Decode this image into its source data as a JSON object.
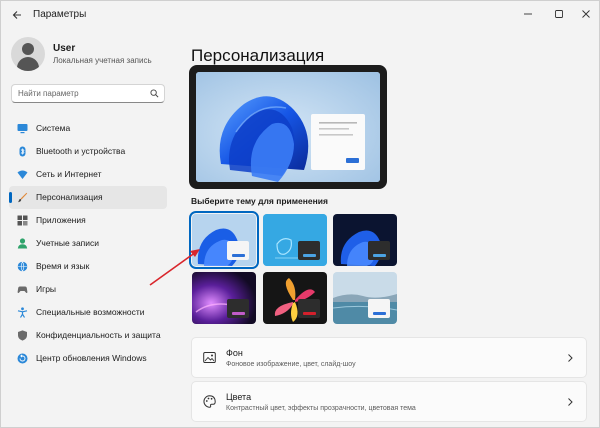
{
  "window": {
    "title": "Параметры"
  },
  "user": {
    "name": "User",
    "subtitle": "Локальная учетная запись"
  },
  "search": {
    "placeholder": "Найти параметр"
  },
  "sidebar": {
    "items": [
      {
        "label": "Система",
        "icon": "system-icon"
      },
      {
        "label": "Bluetooth и устройства",
        "icon": "bluetooth-icon"
      },
      {
        "label": "Сеть и Интернет",
        "icon": "network-icon"
      },
      {
        "label": "Персонализация",
        "icon": "brush-icon",
        "active": true
      },
      {
        "label": "Приложения",
        "icon": "apps-icon"
      },
      {
        "label": "Учетные записи",
        "icon": "accounts-icon"
      },
      {
        "label": "Время и язык",
        "icon": "globe-icon"
      },
      {
        "label": "Игры",
        "icon": "gamepad-icon"
      },
      {
        "label": "Специальные возможности",
        "icon": "accessibility-icon"
      },
      {
        "label": "Конфиденциальность и защита",
        "icon": "shield-icon"
      },
      {
        "label": "Центр обновления Windows",
        "icon": "update-icon"
      }
    ]
  },
  "main": {
    "title": "Персонализация",
    "theme_label": "Выберите тему для применения",
    "cards": [
      {
        "title": "Фон",
        "subtitle": "Фоновое изображение, цвет, слайд-шоу",
        "icon": "image-icon"
      },
      {
        "title": "Цвета",
        "subtitle": "Контрастный цвет, эффекты прозрачности, цветовая тема",
        "icon": "palette-icon"
      }
    ]
  },
  "colors": {
    "accent": "#0067c0",
    "annotation_arrow": "#d9262c"
  }
}
